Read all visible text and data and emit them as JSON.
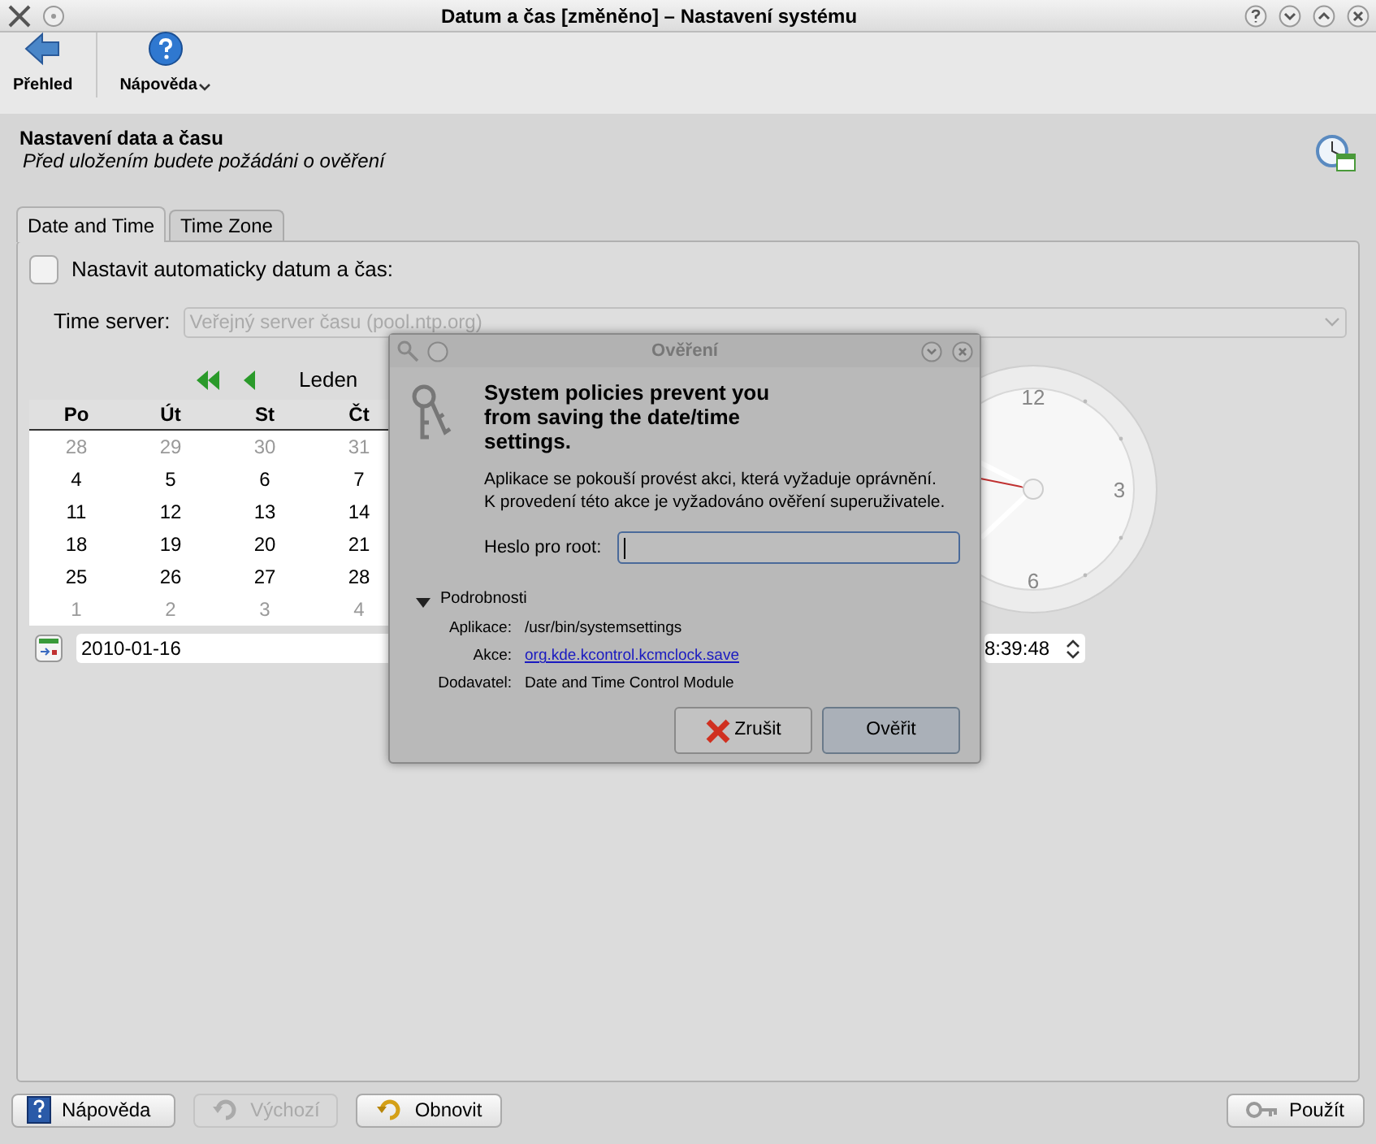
{
  "window": {
    "title": "Datum a čas [změněno] – Nastavení systému"
  },
  "toolbar": [
    {
      "label": "Přehled",
      "kind": "back"
    },
    {
      "label": "Nápověda",
      "kind": "help"
    }
  ],
  "header": {
    "title": "Nastavení data a času",
    "subtitle": "Před uložením budete požádáni o ověření"
  },
  "tabs": [
    {
      "label": "Date and Time",
      "selected": true
    },
    {
      "label": "Time Zone",
      "selected": false
    }
  ],
  "auto_set": {
    "label": "Nastavit automaticky datum a čas:",
    "checked": false
  },
  "time_server": {
    "label": "Time server:",
    "value": "Veřejný server času (pool.ntp.org)",
    "disabled": true
  },
  "calendar": {
    "month": "Leden",
    "weekdays": [
      "Po",
      "Út",
      "St",
      "Čt"
    ],
    "rows": [
      [
        {
          "day": "28",
          "other_month": true
        },
        {
          "day": "29",
          "other_month": true
        },
        {
          "day": "30",
          "other_month": true
        },
        {
          "day": "31",
          "other_month": true
        }
      ],
      [
        {
          "day": "4",
          "other_month": false
        },
        {
          "day": "5",
          "other_month": false
        },
        {
          "day": "6",
          "other_month": false
        },
        {
          "day": "7",
          "other_month": false
        }
      ],
      [
        {
          "day": "11",
          "other_month": false
        },
        {
          "day": "12",
          "other_month": false
        },
        {
          "day": "13",
          "other_month": false
        },
        {
          "day": "14",
          "other_month": false
        }
      ],
      [
        {
          "day": "18",
          "other_month": false
        },
        {
          "day": "19",
          "other_month": false
        },
        {
          "day": "20",
          "other_month": false
        },
        {
          "day": "21",
          "other_month": false
        }
      ],
      [
        {
          "day": "25",
          "other_month": false
        },
        {
          "day": "26",
          "other_month": false
        },
        {
          "day": "27",
          "other_month": false
        },
        {
          "day": "28",
          "other_month": false
        }
      ],
      [
        {
          "day": "1",
          "other_month": true
        },
        {
          "day": "2",
          "other_month": true
        },
        {
          "day": "3",
          "other_month": true
        },
        {
          "day": "4",
          "other_month": true
        }
      ]
    ],
    "date": "2010-01-16"
  },
  "clock": {
    "numerals": [
      "12",
      "3",
      "6"
    ],
    "time": "8:39:48"
  },
  "dialog": {
    "title": "Ověření",
    "heading": "System policies prevent you from saving the date/time settings.",
    "message": [
      "Aplikace se pokouší provést akci, která vyžaduje oprávnění.",
      "K provedení této akce je vyžadováno ověření superuživatele."
    ],
    "password_label": "Heslo pro root:",
    "details": {
      "label": "Podrobnosti",
      "expanded": true,
      "rows": [
        {
          "label": "Aplikace:",
          "value": "/usr/bin/systemsettings",
          "kind": "text"
        },
        {
          "label": "Akce:",
          "value": "org.kde.kcontrol.kcmclock.save",
          "kind": "link"
        },
        {
          "label": "Dodavatel:",
          "value": "Date and Time Control Module",
          "kind": "text"
        }
      ]
    },
    "buttons": [
      {
        "label": "Zrušit",
        "kind": "cancel"
      },
      {
        "label": "Ověřit",
        "kind": "ok"
      }
    ]
  },
  "buttons": [
    {
      "label": "Nápověda",
      "kind": "help",
      "disabled": false
    },
    {
      "label": "Výchozí",
      "kind": "defaults",
      "disabled": true
    },
    {
      "label": "Obnovit",
      "kind": "reset",
      "disabled": false
    },
    {
      "label": "Použít",
      "kind": "apply",
      "disabled": false
    }
  ]
}
